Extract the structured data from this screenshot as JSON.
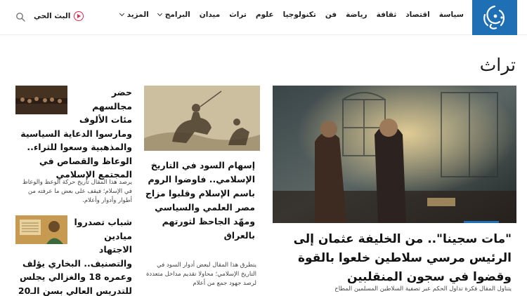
{
  "header": {
    "nav": [
      {
        "label": "سياسة",
        "dropdown": false
      },
      {
        "label": "اقتصاد",
        "dropdown": false
      },
      {
        "label": "ثقافة",
        "dropdown": false
      },
      {
        "label": "رياضة",
        "dropdown": false
      },
      {
        "label": "فن",
        "dropdown": false
      },
      {
        "label": "تكنولوجيا",
        "dropdown": false
      },
      {
        "label": "علوم",
        "dropdown": false
      },
      {
        "label": "تراث",
        "dropdown": false
      },
      {
        "label": "ميدان",
        "dropdown": false
      },
      {
        "label": "البرامج",
        "dropdown": true
      },
      {
        "label": "المزيد",
        "dropdown": true
      }
    ],
    "live_label": "البث الحي"
  },
  "page": {
    "title": "تراث"
  },
  "articles": {
    "main": {
      "headline": "\"مات سجينا\".. من الخليفة عثمان إلى الرئيس مرسي سلاطين خلعوا بالقوة وقضوا في سجون المنقلبين",
      "excerpt": "يتناول المقال فكرة تداول الحكم عبر تصفية السلاطين المسلمين المطاح"
    },
    "middle": {
      "headline": "إسهام السود في التاريخ الإسلامي.. فاوضوا الروم باسم الإسلام وقلبوا مزاج مصر العلمي والسياسي ومهّد الجاحظ لثورتهم بالعراق",
      "excerpt": "يتطرق هذا المقال لبعض أدوار السود في التاريخ الإسلامي؛ محاولا تقديم مداخل متعددة لرصد جهود جمع من أعلام"
    },
    "side_1": {
      "headline": "حضر مجالسهم مئات الألوف ومارسوا الدعاية السياسية والمذهبية وسعوا للثراء.. الوعاظ والقصاص في المجتمع الإسلامي",
      "excerpt": "يرصد هذا المقال تاريخ حركة الوعظ والوعاظ في الإسلام؛ فيقف على بعض ما عرفته من أطوار وأدوار وأعلام."
    },
    "side_2": {
      "headline": "شباب تصدروا ميادين الاجتهاد والتصنيف.. البخاري يؤلف وعمره 18 والغزالي يجلس للتدريس العالي بسن الـ20"
    }
  },
  "colors": {
    "brand": "#1f6fb5",
    "live": "#e0284f"
  },
  "icons": {
    "logo": "aljazeera-logo-icon",
    "live": "play-circle-icon",
    "search": "search-icon"
  }
}
